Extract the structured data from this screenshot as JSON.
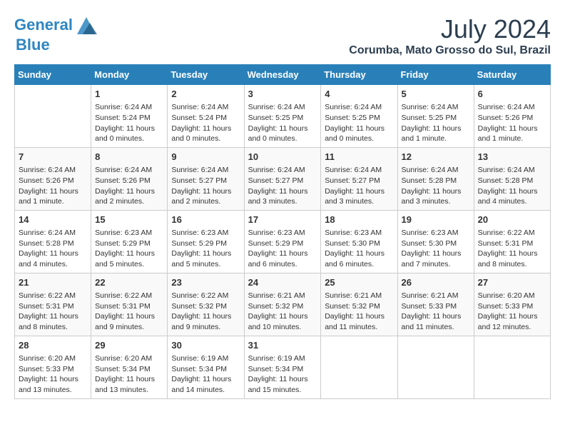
{
  "header": {
    "logo_line1": "General",
    "logo_line2": "Blue",
    "month": "July 2024",
    "location": "Corumba, Mato Grosso do Sul, Brazil"
  },
  "days_of_week": [
    "Sunday",
    "Monday",
    "Tuesday",
    "Wednesday",
    "Thursday",
    "Friday",
    "Saturday"
  ],
  "weeks": [
    [
      {
        "day": "",
        "content": ""
      },
      {
        "day": "1",
        "content": "Sunrise: 6:24 AM\nSunset: 5:24 PM\nDaylight: 11 hours and 0 minutes."
      },
      {
        "day": "2",
        "content": "Sunrise: 6:24 AM\nSunset: 5:24 PM\nDaylight: 11 hours and 0 minutes."
      },
      {
        "day": "3",
        "content": "Sunrise: 6:24 AM\nSunset: 5:25 PM\nDaylight: 11 hours and 0 minutes."
      },
      {
        "day": "4",
        "content": "Sunrise: 6:24 AM\nSunset: 5:25 PM\nDaylight: 11 hours and 0 minutes."
      },
      {
        "day": "5",
        "content": "Sunrise: 6:24 AM\nSunset: 5:25 PM\nDaylight: 11 hours and 1 minute."
      },
      {
        "day": "6",
        "content": "Sunrise: 6:24 AM\nSunset: 5:26 PM\nDaylight: 11 hours and 1 minute."
      }
    ],
    [
      {
        "day": "7",
        "content": "Sunrise: 6:24 AM\nSunset: 5:26 PM\nDaylight: 11 hours and 1 minute."
      },
      {
        "day": "8",
        "content": "Sunrise: 6:24 AM\nSunset: 5:26 PM\nDaylight: 11 hours and 2 minutes."
      },
      {
        "day": "9",
        "content": "Sunrise: 6:24 AM\nSunset: 5:27 PM\nDaylight: 11 hours and 2 minutes."
      },
      {
        "day": "10",
        "content": "Sunrise: 6:24 AM\nSunset: 5:27 PM\nDaylight: 11 hours and 3 minutes."
      },
      {
        "day": "11",
        "content": "Sunrise: 6:24 AM\nSunset: 5:27 PM\nDaylight: 11 hours and 3 minutes."
      },
      {
        "day": "12",
        "content": "Sunrise: 6:24 AM\nSunset: 5:28 PM\nDaylight: 11 hours and 3 minutes."
      },
      {
        "day": "13",
        "content": "Sunrise: 6:24 AM\nSunset: 5:28 PM\nDaylight: 11 hours and 4 minutes."
      }
    ],
    [
      {
        "day": "14",
        "content": "Sunrise: 6:24 AM\nSunset: 5:28 PM\nDaylight: 11 hours and 4 minutes."
      },
      {
        "day": "15",
        "content": "Sunrise: 6:23 AM\nSunset: 5:29 PM\nDaylight: 11 hours and 5 minutes."
      },
      {
        "day": "16",
        "content": "Sunrise: 6:23 AM\nSunset: 5:29 PM\nDaylight: 11 hours and 5 minutes."
      },
      {
        "day": "17",
        "content": "Sunrise: 6:23 AM\nSunset: 5:29 PM\nDaylight: 11 hours and 6 minutes."
      },
      {
        "day": "18",
        "content": "Sunrise: 6:23 AM\nSunset: 5:30 PM\nDaylight: 11 hours and 6 minutes."
      },
      {
        "day": "19",
        "content": "Sunrise: 6:23 AM\nSunset: 5:30 PM\nDaylight: 11 hours and 7 minutes."
      },
      {
        "day": "20",
        "content": "Sunrise: 6:22 AM\nSunset: 5:31 PM\nDaylight: 11 hours and 8 minutes."
      }
    ],
    [
      {
        "day": "21",
        "content": "Sunrise: 6:22 AM\nSunset: 5:31 PM\nDaylight: 11 hours and 8 minutes."
      },
      {
        "day": "22",
        "content": "Sunrise: 6:22 AM\nSunset: 5:31 PM\nDaylight: 11 hours and 9 minutes."
      },
      {
        "day": "23",
        "content": "Sunrise: 6:22 AM\nSunset: 5:32 PM\nDaylight: 11 hours and 9 minutes."
      },
      {
        "day": "24",
        "content": "Sunrise: 6:21 AM\nSunset: 5:32 PM\nDaylight: 11 hours and 10 minutes."
      },
      {
        "day": "25",
        "content": "Sunrise: 6:21 AM\nSunset: 5:32 PM\nDaylight: 11 hours and 11 minutes."
      },
      {
        "day": "26",
        "content": "Sunrise: 6:21 AM\nSunset: 5:33 PM\nDaylight: 11 hours and 11 minutes."
      },
      {
        "day": "27",
        "content": "Sunrise: 6:20 AM\nSunset: 5:33 PM\nDaylight: 11 hours and 12 minutes."
      }
    ],
    [
      {
        "day": "28",
        "content": "Sunrise: 6:20 AM\nSunset: 5:33 PM\nDaylight: 11 hours and 13 minutes."
      },
      {
        "day": "29",
        "content": "Sunrise: 6:20 AM\nSunset: 5:34 PM\nDaylight: 11 hours and 13 minutes."
      },
      {
        "day": "30",
        "content": "Sunrise: 6:19 AM\nSunset: 5:34 PM\nDaylight: 11 hours and 14 minutes."
      },
      {
        "day": "31",
        "content": "Sunrise: 6:19 AM\nSunset: 5:34 PM\nDaylight: 11 hours and 15 minutes."
      },
      {
        "day": "",
        "content": ""
      },
      {
        "day": "",
        "content": ""
      },
      {
        "day": "",
        "content": ""
      }
    ]
  ]
}
